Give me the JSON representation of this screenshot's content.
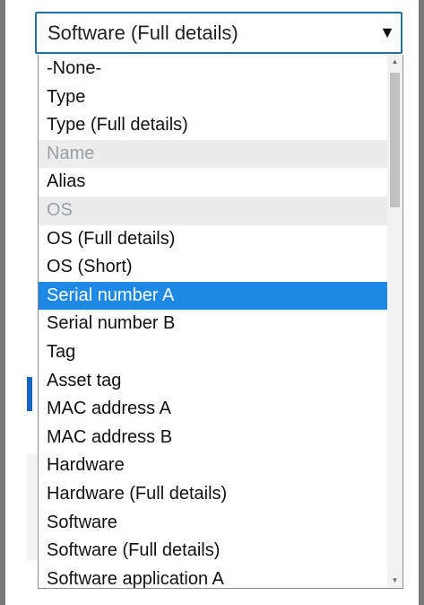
{
  "select": {
    "selected_value": "Software (Full details)",
    "caret_glyph": "▼"
  },
  "dropdown": {
    "options": [
      {
        "label": "-None-",
        "state": "normal"
      },
      {
        "label": "Type",
        "state": "normal"
      },
      {
        "label": "Type (Full details)",
        "state": "normal"
      },
      {
        "label": "Name",
        "state": "disabled"
      },
      {
        "label": "Alias",
        "state": "normal"
      },
      {
        "label": "OS",
        "state": "disabled"
      },
      {
        "label": "OS (Full details)",
        "state": "normal"
      },
      {
        "label": "OS (Short)",
        "state": "normal"
      },
      {
        "label": "Serial number A",
        "state": "highlighted"
      },
      {
        "label": "Serial number B",
        "state": "normal"
      },
      {
        "label": "Tag",
        "state": "normal"
      },
      {
        "label": "Asset tag",
        "state": "normal"
      },
      {
        "label": "MAC address A",
        "state": "normal"
      },
      {
        "label": "MAC address B",
        "state": "normal"
      },
      {
        "label": "Hardware",
        "state": "normal"
      },
      {
        "label": "Hardware (Full details)",
        "state": "normal"
      },
      {
        "label": "Software",
        "state": "normal"
      },
      {
        "label": "Software (Full details)",
        "state": "normal"
      },
      {
        "label": "Software application A",
        "state": "normal"
      }
    ]
  },
  "scrollbar": {
    "up_glyph": "▲",
    "down_glyph": "▼"
  },
  "colors": {
    "highlight": "#1e88e5",
    "disabled_bg": "#ececec",
    "disabled_text": "#9aa0a6",
    "select_border": "#1f6f9f"
  }
}
